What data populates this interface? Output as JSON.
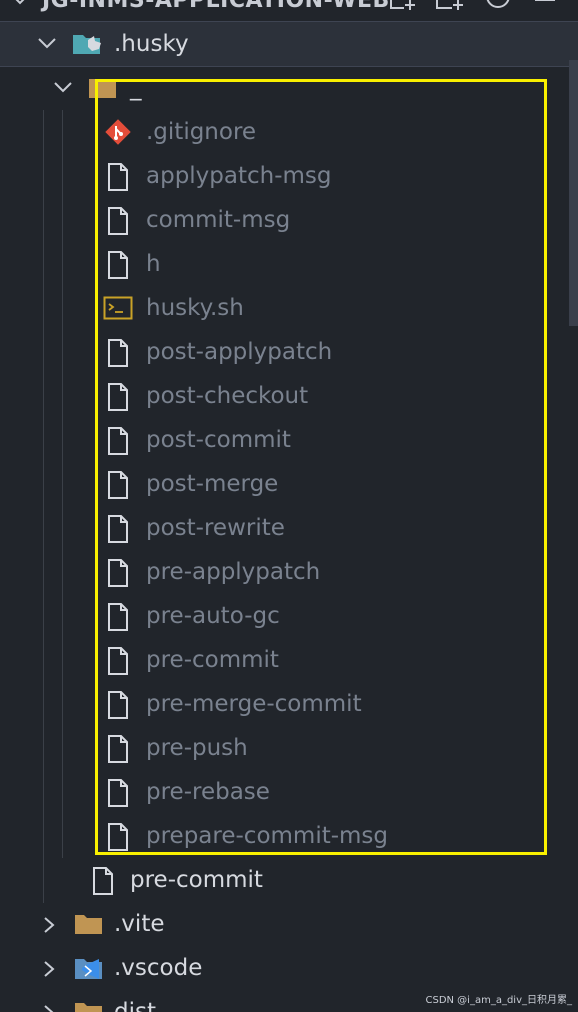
{
  "explorer": {
    "project_title": "JG-INMS-APPLICATION-WEB"
  },
  "tree": {
    "husky_folder": ".husky",
    "underscore_folder": "_",
    "files": [
      {
        "name": ".gitignore",
        "icon": "git-icon"
      },
      {
        "name": "applypatch-msg",
        "icon": "file-icon"
      },
      {
        "name": "commit-msg",
        "icon": "file-icon"
      },
      {
        "name": "h",
        "icon": "file-icon"
      },
      {
        "name": "husky.sh",
        "icon": "shell-script-icon"
      },
      {
        "name": "post-applypatch",
        "icon": "file-icon"
      },
      {
        "name": "post-checkout",
        "icon": "file-icon"
      },
      {
        "name": "post-commit",
        "icon": "file-icon"
      },
      {
        "name": "post-merge",
        "icon": "file-icon"
      },
      {
        "name": "post-rewrite",
        "icon": "file-icon"
      },
      {
        "name": "pre-applypatch",
        "icon": "file-icon"
      },
      {
        "name": "pre-auto-gc",
        "icon": "file-icon"
      },
      {
        "name": "pre-commit",
        "icon": "file-icon"
      },
      {
        "name": "pre-merge-commit",
        "icon": "file-icon"
      },
      {
        "name": "pre-push",
        "icon": "file-icon"
      },
      {
        "name": "pre-rebase",
        "icon": "file-icon"
      },
      {
        "name": "prepare-commit-msg",
        "icon": "file-icon"
      }
    ],
    "husky_precommit": "pre-commit",
    "vite_folder": ".vite",
    "vscode_folder": ".vscode",
    "dist_folder": "dist"
  },
  "colors": {
    "background": "#21252b",
    "dim_text": "#7a828f",
    "bright_text": "#d7dae0",
    "highlight_border": "#f9f000",
    "git_icon": "#e44d3a",
    "folder": "#c09553",
    "vscode_icon": "#3b8eea"
  },
  "watermark": "CSDN @i_am_a_div_日积月累_"
}
